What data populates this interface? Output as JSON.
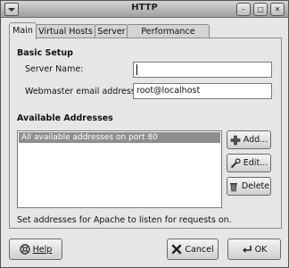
{
  "window": {
    "title": "HTTP"
  },
  "tabs": [
    {
      "label": "Main",
      "active": true
    },
    {
      "label": "Virtual Hosts",
      "active": false
    },
    {
      "label": "Server",
      "active": false
    },
    {
      "label": "Performance Tuning",
      "active": false
    }
  ],
  "basic_setup": {
    "heading": "Basic Setup",
    "server_name_label": "Server Name:",
    "server_name_value": "",
    "webmaster_label": "Webmaster email address:",
    "webmaster_value": "root@localhost"
  },
  "addresses": {
    "heading": "Available Addresses",
    "items": [
      "All available addresses on port 80"
    ],
    "selected_index": 0,
    "add_label": "Add...",
    "edit_label": "Edit...",
    "delete_label": "Delete",
    "hint": "Set addresses for Apache to listen for requests on."
  },
  "footer": {
    "help_label": "Help",
    "cancel_label": "Cancel",
    "ok_label": "OK"
  }
}
